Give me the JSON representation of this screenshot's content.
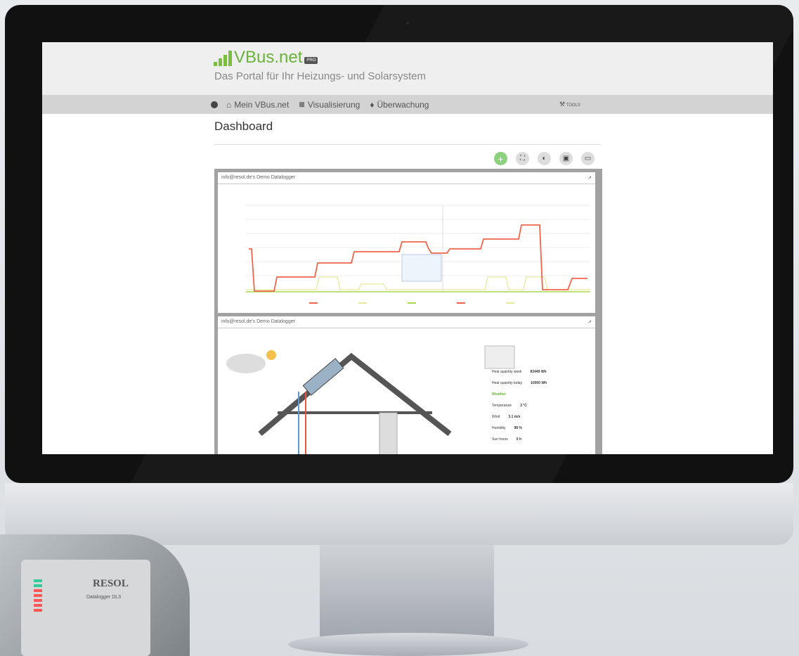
{
  "app": {
    "logo": "VBus.net",
    "logo_badge": "PRO",
    "subtitle": "Das Portal für Ihr Heizungs- und Solarsystem"
  },
  "nav": {
    "items": [
      {
        "icon": "home-icon",
        "label": "Mein VBus.net"
      },
      {
        "icon": "chart-icon",
        "label": "Visualisierung"
      },
      {
        "icon": "bell-icon",
        "label": "Überwachung"
      }
    ],
    "tools_label": "TOOLS"
  },
  "dashboard": {
    "title": "Dashboard",
    "toolbar": [
      "add",
      "fullscreen",
      "contrast",
      "window",
      "delete"
    ]
  },
  "widgets": [
    {
      "title": "info@resol.de's Demo Datalogger",
      "type": "chart"
    },
    {
      "title": "info@resol.de's Demo Datalogger",
      "type": "system-scheme"
    }
  ],
  "system_info": {
    "heat_quantity_week": {
      "label": "Heat quantity week",
      "value": "83449 Wh"
    },
    "heat_quantity_today": {
      "label": "Heat quantity today",
      "value": "10000 Wh"
    },
    "weather_title": "Weather",
    "temperature": {
      "label": "Temperature",
      "value": "3 °C"
    },
    "wind": {
      "label": "Wind",
      "value": "3.1 m/s"
    },
    "humidity": {
      "label": "Humidity",
      "value": "98 %"
    },
    "sun_hours": {
      "label": "Sun hours",
      "value": "0 h"
    }
  },
  "device": {
    "brand": "RESOL",
    "model": "Datalogger DL3"
  },
  "colors": {
    "accent": "#6ab33a",
    "series_temp": "#f0654a",
    "series_pump": "#e7e79a",
    "series_relay": "#a9d94f"
  }
}
